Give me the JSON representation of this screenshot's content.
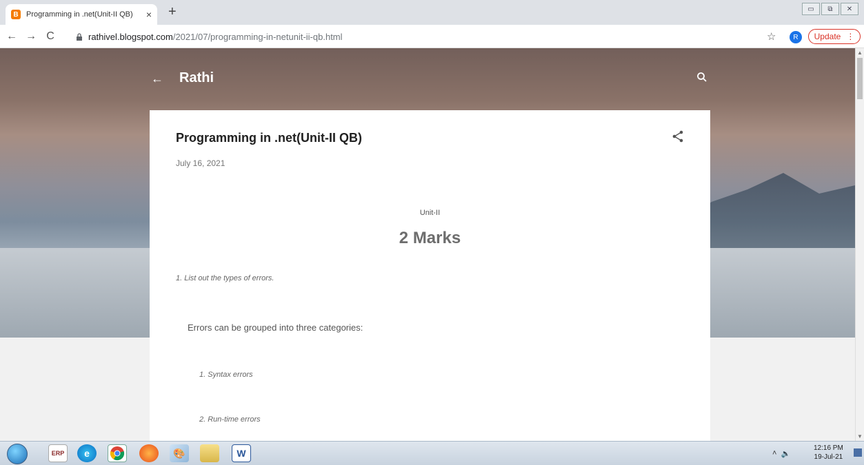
{
  "browser": {
    "tab_title": "Programming in .net(Unit-II QB)",
    "tab_close": "×",
    "new_tab": "+",
    "url_host": "rathivel.blogspot.com",
    "url_path": "/2021/07/programming-in-netunit-ii-qb.html",
    "profile_initial": "R",
    "update_label": "Update"
  },
  "blog": {
    "site_title": "Rathi"
  },
  "post": {
    "title": "Programming in .net(Unit-II QB)",
    "date": "July 16, 2021",
    "unit": "Unit-II",
    "marks_heading": "2 Marks",
    "question_1": "1. List out the types of errors.",
    "answer_intro": "Errors can be grouped into three categories:",
    "list_item_1": "1. Syntax errors",
    "list_item_2": "2. Run-time errors"
  },
  "taskbar": {
    "clock_time": "12:16 PM",
    "clock_date": "19-Jul-21"
  },
  "colors": {
    "update_accent": "#d93025",
    "profile": "#1a73e8"
  }
}
